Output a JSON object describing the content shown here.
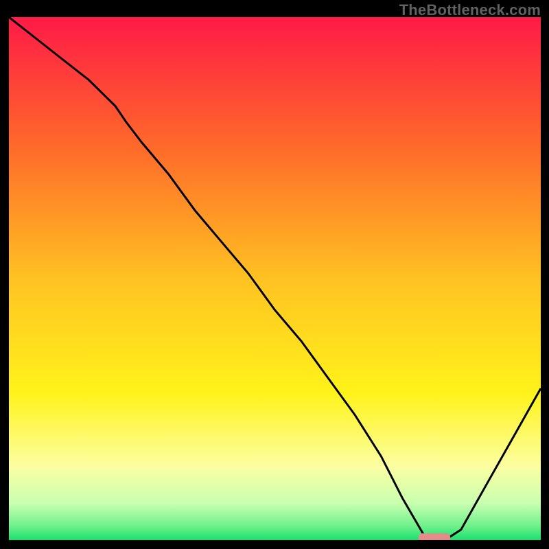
{
  "watermark": "TheBottleneck.com",
  "chart_data": {
    "type": "line",
    "title": "",
    "xlabel": "",
    "ylabel": "",
    "xlim": [
      0,
      100
    ],
    "ylim": [
      0,
      100
    ],
    "grid": false,
    "legend": false,
    "background_gradient": {
      "stops": [
        {
          "pos": 0.0,
          "color": "#ff1a47"
        },
        {
          "pos": 0.25,
          "color": "#ff6a2a"
        },
        {
          "pos": 0.5,
          "color": "#ffc222"
        },
        {
          "pos": 0.72,
          "color": "#fff31a"
        },
        {
          "pos": 0.86,
          "color": "#fbffa2"
        },
        {
          "pos": 0.93,
          "color": "#c8ffb0"
        },
        {
          "pos": 0.975,
          "color": "#6af089"
        },
        {
          "pos": 1.0,
          "color": "#19e070"
        }
      ]
    },
    "series": [
      {
        "name": "bottleneck-curve",
        "color": "#000000",
        "x": [
          0,
          5,
          10,
          15,
          20,
          22,
          25,
          30,
          35,
          40,
          45,
          50,
          55,
          60,
          65,
          70,
          74,
          78,
          80,
          82,
          85,
          90,
          95,
          100
        ],
        "y": [
          100,
          96,
          92,
          88,
          83,
          80,
          76,
          70,
          63,
          57,
          51,
          44,
          38,
          31,
          24,
          16,
          8,
          1,
          0,
          0,
          2,
          11,
          20,
          29
        ]
      }
    ],
    "marker": {
      "name": "optimal-range",
      "color": "#e58b8a",
      "x_start": 77,
      "x_end": 83,
      "y": 0.5,
      "shape": "rounded-bar"
    }
  }
}
